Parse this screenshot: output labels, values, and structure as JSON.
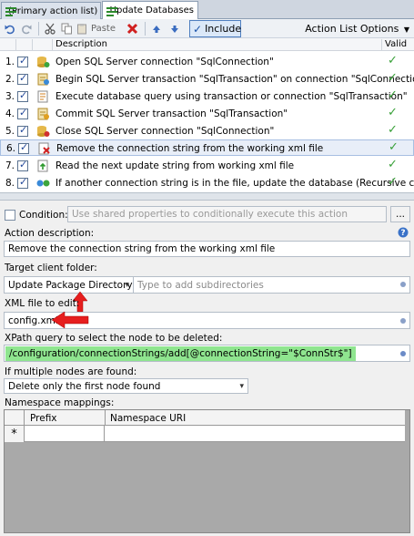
{
  "tabs": [
    {
      "label": "(Primary action list)"
    },
    {
      "label": "Update Databases"
    }
  ],
  "toolbar": {
    "paste_label": "Paste",
    "include_label": "Include",
    "options_label": "Action List Options"
  },
  "grid": {
    "col_description": "Description",
    "col_valid": "Valid",
    "rows": [
      {
        "num": "1.",
        "icon": "database-connection-icon",
        "text": "Open SQL Server connection \"SqlConnection\"",
        "checked": true,
        "valid": true
      },
      {
        "num": "2.",
        "icon": "transaction-begin-icon",
        "text": "Begin SQL Server transaction \"SqlTransaction\" on connection \"SqlConnection\"",
        "checked": true,
        "valid": true
      },
      {
        "num": "3.",
        "icon": "execute-query-icon",
        "text": "Execute database query using transaction or connection \"SqlTransaction\"",
        "checked": true,
        "valid": true
      },
      {
        "num": "4.",
        "icon": "commit-transaction-icon",
        "text": "Commit SQL Server transaction \"SqlTransaction\"",
        "checked": true,
        "valid": true
      },
      {
        "num": "5.",
        "icon": "close-connection-icon",
        "text": "Close SQL Server connection \"SqlConnection\"",
        "checked": true,
        "valid": true
      },
      {
        "num": "6.",
        "icon": "remove-xml-node-icon",
        "text": "Remove the connection string from the working xml file",
        "checked": true,
        "valid": true,
        "selected": true
      },
      {
        "num": "7.",
        "icon": "read-file-icon",
        "text": "Read the next update string from working xml file",
        "checked": true,
        "valid": true
      },
      {
        "num": "8.",
        "icon": "recursive-call-icon",
        "text": "If another connection string is in the file, update the database (Recursive call)",
        "checked": true,
        "valid": true
      }
    ]
  },
  "properties": {
    "condition_label": "Condition:",
    "condition_placeholder": "Use shared properties to conditionally execute this action",
    "condition_button": "...",
    "action_desc_label": "Action description:",
    "action_desc_value": "Remove the connection string from the working xml file",
    "target_folder_label": "Target client folder:",
    "target_folder_value": "Update Package Directory",
    "subdir_placeholder": "Type to add subdirectories",
    "xml_file_label": "XML file to edit:",
    "xml_file_value": "config.xml",
    "xpath_label": "XPath query to select the node to be deleted:",
    "xpath_value": "/configuration/connectionStrings/add[@connectionString=\"$ConnStr$\"]",
    "multiple_label": "If multiple nodes are found:",
    "multiple_value": "Delete only the first node found",
    "namespace_label": "Namespace mappings:",
    "ns_col_prefix": "Prefix",
    "ns_col_uri": "Namespace URI",
    "ns_new_row_marker": "*"
  }
}
